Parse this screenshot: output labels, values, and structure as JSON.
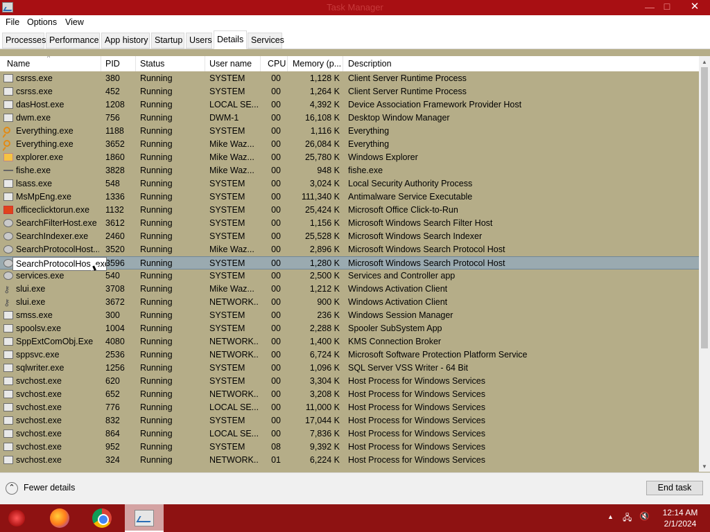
{
  "window": {
    "title": "Task Manager",
    "min": "—",
    "max": "☐",
    "close": "✕"
  },
  "menu": [
    "File",
    "Options",
    "View"
  ],
  "tabs": [
    "Processes",
    "Performance",
    "App history",
    "Startup",
    "Users",
    "Details",
    "Services"
  ],
  "active_tab": "Details",
  "columns": {
    "name": "Name",
    "pid": "PID",
    "status": "Status",
    "user": "User name",
    "cpu": "CPU",
    "memory": "Memory (p...",
    "description": "Description"
  },
  "rows": [
    {
      "icon": "window-icon",
      "name": "csrss.exe",
      "pid": "380",
      "status": "Running",
      "user": "SYSTEM",
      "cpu": "00",
      "memory": "1,128 K",
      "description": "Client Server Runtime Process"
    },
    {
      "icon": "window-icon",
      "name": "csrss.exe",
      "pid": "452",
      "status": "Running",
      "user": "SYSTEM",
      "cpu": "00",
      "memory": "1,264 K",
      "description": "Client Server Runtime Process"
    },
    {
      "icon": "window-icon",
      "name": "dasHost.exe",
      "pid": "1208",
      "status": "Running",
      "user": "LOCAL SE...",
      "cpu": "00",
      "memory": "4,392 K",
      "description": "Device Association Framework Provider Host"
    },
    {
      "icon": "window-icon",
      "name": "dwm.exe",
      "pid": "756",
      "status": "Running",
      "user": "DWM-1",
      "cpu": "00",
      "memory": "16,108 K",
      "description": "Desktop Window Manager"
    },
    {
      "icon": "magnifier-icon",
      "name": "Everything.exe",
      "pid": "1188",
      "status": "Running",
      "user": "SYSTEM",
      "cpu": "00",
      "memory": "1,116 K",
      "description": "Everything"
    },
    {
      "icon": "magnifier-icon",
      "name": "Everything.exe",
      "pid": "3652",
      "status": "Running",
      "user": "Mike Waz...",
      "cpu": "00",
      "memory": "26,084 K",
      "description": "Everything"
    },
    {
      "icon": "folder-icon",
      "name": "explorer.exe",
      "pid": "1860",
      "status": "Running",
      "user": "Mike Waz...",
      "cpu": "00",
      "memory": "25,780 K",
      "description": "Windows Explorer"
    },
    {
      "icon": "pipe-icon",
      "name": "fishe.exe",
      "pid": "3828",
      "status": "Running",
      "user": "Mike Waz...",
      "cpu": "00",
      "memory": "948 K",
      "description": "fishe.exe"
    },
    {
      "icon": "window-icon",
      "name": "lsass.exe",
      "pid": "548",
      "status": "Running",
      "user": "SYSTEM",
      "cpu": "00",
      "memory": "3,024 K",
      "description": "Local Security Authority Process"
    },
    {
      "icon": "window-icon",
      "name": "MsMpEng.exe",
      "pid": "1336",
      "status": "Running",
      "user": "SYSTEM",
      "cpu": "00",
      "memory": "111,340 K",
      "description": "Antimalware Service Executable"
    },
    {
      "icon": "office-icon",
      "name": "officeclicktorun.exe",
      "pid": "1132",
      "status": "Running",
      "user": "SYSTEM",
      "cpu": "00",
      "memory": "25,424 K",
      "description": "Microsoft Office Click-to-Run"
    },
    {
      "icon": "search-user-icon",
      "name": "SearchFilterHost.exe",
      "pid": "3612",
      "status": "Running",
      "user": "SYSTEM",
      "cpu": "00",
      "memory": "1,156 K",
      "description": "Microsoft Windows Search Filter Host"
    },
    {
      "icon": "search-user-icon",
      "name": "SearchIndexer.exe",
      "pid": "2460",
      "status": "Running",
      "user": "SYSTEM",
      "cpu": "00",
      "memory": "25,528 K",
      "description": "Microsoft Windows Search Indexer"
    },
    {
      "icon": "search-user-icon",
      "name": "SearchProtocolHost....",
      "pid": "3520",
      "status": "Running",
      "user": "Mike Waz...",
      "cpu": "00",
      "memory": "2,896 K",
      "description": "Microsoft Windows Search Protocol Host"
    },
    {
      "icon": "search-user-icon",
      "name": "SearchProtocolHost.exe",
      "pid": "3596",
      "status": "Running",
      "user": "SYSTEM",
      "cpu": "00",
      "memory": "1,280 K",
      "description": "Microsoft Windows Search Protocol Host",
      "selected": true
    },
    {
      "icon": "gear-icon",
      "name": "services.exe",
      "pid": "540",
      "status": "Running",
      "user": "SYSTEM",
      "cpu": "00",
      "memory": "2,500 K",
      "description": "Services and Controller app"
    },
    {
      "icon": "key-icon",
      "name": "slui.exe",
      "pid": "3708",
      "status": "Running",
      "user": "Mike Waz...",
      "cpu": "00",
      "memory": "1,212 K",
      "description": "Windows Activation Client"
    },
    {
      "icon": "key-icon",
      "name": "slui.exe",
      "pid": "3672",
      "status": "Running",
      "user": "NETWORK...",
      "cpu": "00",
      "memory": "900 K",
      "description": "Windows Activation Client"
    },
    {
      "icon": "window-icon",
      "name": "smss.exe",
      "pid": "300",
      "status": "Running",
      "user": "SYSTEM",
      "cpu": "00",
      "memory": "236 K",
      "description": "Windows Session Manager"
    },
    {
      "icon": "printer-icon",
      "name": "spoolsv.exe",
      "pid": "1004",
      "status": "Running",
      "user": "SYSTEM",
      "cpu": "00",
      "memory": "2,288 K",
      "description": "Spooler SubSystem App"
    },
    {
      "icon": "window-icon",
      "name": "SppExtComObj.Exe",
      "pid": "4080",
      "status": "Running",
      "user": "NETWORK...",
      "cpu": "00",
      "memory": "1,400 K",
      "description": "KMS Connection Broker"
    },
    {
      "icon": "window-icon",
      "name": "sppsvc.exe",
      "pid": "2536",
      "status": "Running",
      "user": "NETWORK...",
      "cpu": "00",
      "memory": "6,724 K",
      "description": "Microsoft Software Protection Platform Service"
    },
    {
      "icon": "window-icon",
      "name": "sqlwriter.exe",
      "pid": "1256",
      "status": "Running",
      "user": "SYSTEM",
      "cpu": "00",
      "memory": "1,096 K",
      "description": "SQL Server VSS Writer - 64 Bit"
    },
    {
      "icon": "window-icon",
      "name": "svchost.exe",
      "pid": "620",
      "status": "Running",
      "user": "SYSTEM",
      "cpu": "00",
      "memory": "3,304 K",
      "description": "Host Process for Windows Services"
    },
    {
      "icon": "window-icon",
      "name": "svchost.exe",
      "pid": "652",
      "status": "Running",
      "user": "NETWORK...",
      "cpu": "00",
      "memory": "3,208 K",
      "description": "Host Process for Windows Services"
    },
    {
      "icon": "window-icon",
      "name": "svchost.exe",
      "pid": "776",
      "status": "Running",
      "user": "LOCAL SE...",
      "cpu": "00",
      "memory": "11,000 K",
      "description": "Host Process for Windows Services"
    },
    {
      "icon": "window-icon",
      "name": "svchost.exe",
      "pid": "832",
      "status": "Running",
      "user": "SYSTEM",
      "cpu": "00",
      "memory": "17,044 K",
      "description": "Host Process for Windows Services"
    },
    {
      "icon": "window-icon",
      "name": "svchost.exe",
      "pid": "864",
      "status": "Running",
      "user": "LOCAL SE...",
      "cpu": "00",
      "memory": "7,836 K",
      "description": "Host Process for Windows Services"
    },
    {
      "icon": "window-icon",
      "name": "svchost.exe",
      "pid": "952",
      "status": "Running",
      "user": "SYSTEM",
      "cpu": "08",
      "memory": "9,392 K",
      "description": "Host Process for Windows Services"
    },
    {
      "icon": "window-icon",
      "name": "svchost.exe",
      "pid": "324",
      "status": "Running",
      "user": "NETWORK...",
      "cpu": "01",
      "memory": "6,224 K",
      "description": "Host Process for Windows Services"
    }
  ],
  "tooltip": "SearchProtocolHost.exe",
  "footer": {
    "fewer_details": "Fewer details",
    "end_task": "End task"
  },
  "taskbar": {
    "apps": [
      "firefox-icon",
      "chrome-icon",
      "task-manager-icon"
    ],
    "time": "12:14 AM",
    "date": "2/1/2024"
  },
  "colors": {
    "titlebar": "#a80f13",
    "taskbar": "#8e1212",
    "grid_background": "#b5ad88",
    "selection": "#9aaab0"
  }
}
